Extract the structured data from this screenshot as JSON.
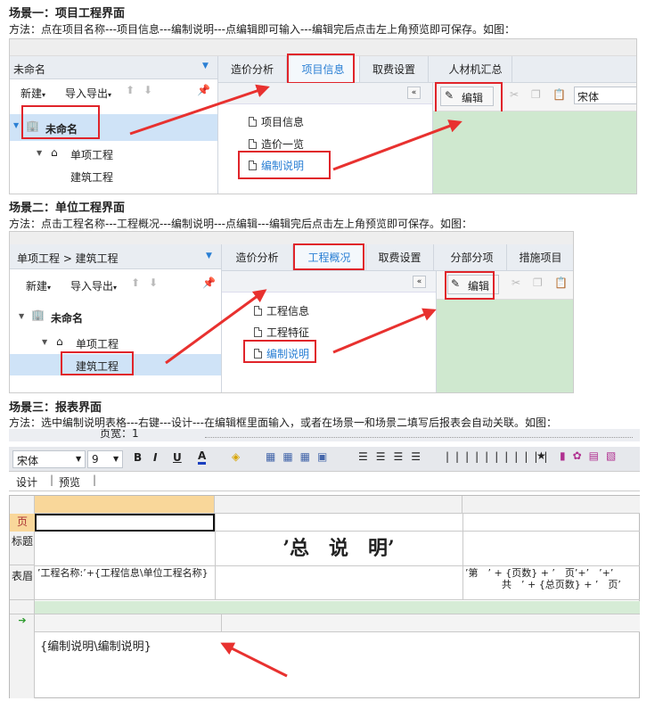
{
  "scene1": {
    "heading": "场景一：项目工程界面",
    "desc": "方法：点在项目名称---项目信息---编制说明---点编辑即可输入---编辑完后点击左上角预览即可保存。如图：",
    "dropdown": "未命名",
    "tabs": [
      "造价分析",
      "项目信息",
      "取费设置",
      "人材机汇总"
    ],
    "toolbar": {
      "new": "新建",
      "import": "导入导出"
    },
    "tree": [
      "未命名",
      "单项工程",
      "建筑工程"
    ],
    "list": [
      "项目信息",
      "造价一览",
      "编制说明"
    ],
    "edit": "编辑",
    "font": "宋体"
  },
  "scene2": {
    "heading": "场景二：单位工程界面",
    "desc": "方法：点击工程名称---工程概况---编制说明---点编辑---编辑完后点击左上角预览即可保存。如图：",
    "breadcrumb": "单项工程 > 建筑工程",
    "tabs": [
      "造价分析",
      "工程概况",
      "取费设置",
      "分部分项",
      "措施项目"
    ],
    "toolbar": {
      "new": "新建",
      "import": "导入导出"
    },
    "tree": [
      "未命名",
      "单项工程",
      "建筑工程"
    ],
    "list": [
      "工程信息",
      "工程特征",
      "编制说明"
    ],
    "edit": "编辑"
  },
  "scene3": {
    "heading": "场景三：报表界面",
    "desc": "方法：选中编制说明表格---右键---设计---在编辑框里面输入，或者在场景一和场景二填写后报表会自动关联。如图：",
    "zoom_label": "页宽：1",
    "font": "宋体",
    "font_size": "9",
    "tabs": [
      "设计",
      "预览"
    ],
    "rows": [
      "页",
      "标题",
      "表眉"
    ],
    "title_text": "’总　说　明’",
    "left_text": "’工程名称:’+{工程信息\\单位工程名称}",
    "right_text_1": "’第　’ + {页数} + ’　页’+’　’+’",
    "right_text_2": "共　’ + {总页数} + ’　页’",
    "content_text": "{编制说明\\编制说明}"
  }
}
